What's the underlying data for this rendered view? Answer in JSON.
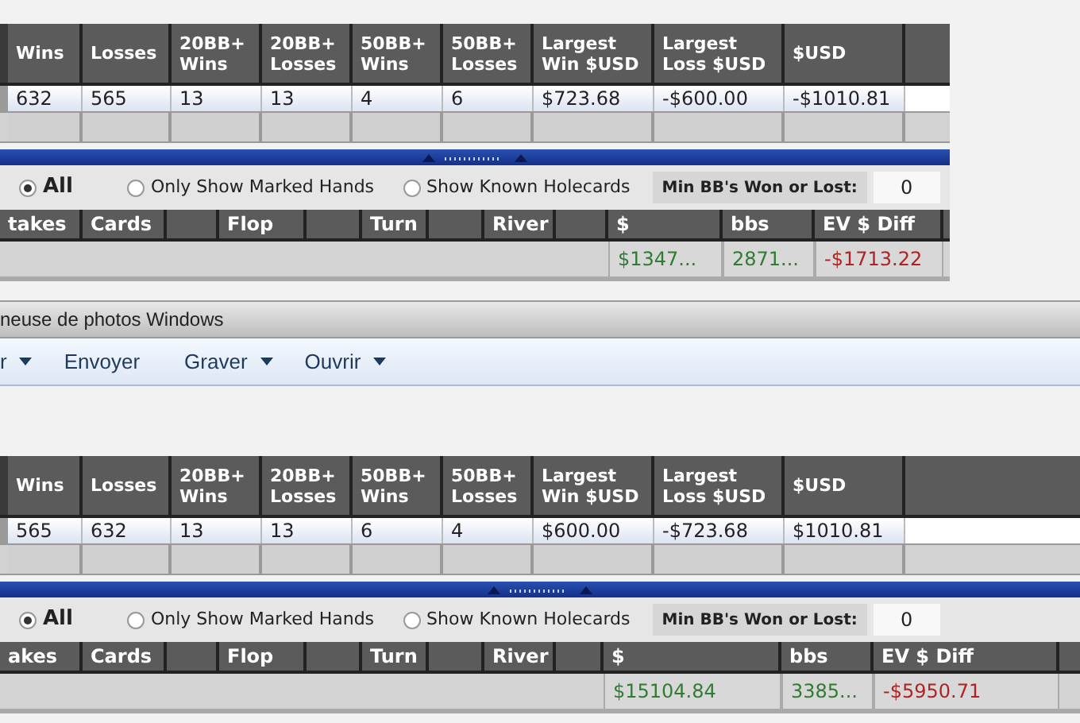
{
  "top_capture": {
    "stats_table": {
      "columns": [
        "Wins",
        "Losses",
        "20BB+ Wins",
        "20BB+ Losses",
        "50BB+ Wins",
        "50BB+ Losses",
        "Largest Win $USD",
        "Largest Loss $USD",
        "$USD"
      ],
      "row": [
        "632",
        "565",
        "13",
        "13",
        "4",
        "6",
        "$723.68",
        "-$600.00",
        "-$1010.81"
      ]
    },
    "filters": {
      "options": [
        {
          "label": "All",
          "selected": true
        },
        {
          "label": "Only Show Marked Hands",
          "selected": false
        },
        {
          "label": "Show Known Holecards",
          "selected": false
        }
      ],
      "min_label": "Min BB's Won or Lost:",
      "min_value": "0"
    },
    "hands_table": {
      "columns": [
        {
          "kind": "label",
          "label": "takes"
        },
        {
          "kind": "label",
          "label": "Cards"
        },
        {
          "kind": "blank"
        },
        {
          "kind": "label",
          "label": "Flop"
        },
        {
          "kind": "blank"
        },
        {
          "kind": "label",
          "label": "Turn"
        },
        {
          "kind": "blank"
        },
        {
          "kind": "label",
          "label": "River"
        },
        {
          "kind": "blank"
        },
        {
          "kind": "label",
          "label": "$",
          "total": "$1347...",
          "color": "#2e7d32"
        },
        {
          "kind": "label",
          "label": "bbs",
          "total": "2871...",
          "color": "#2e7d32"
        },
        {
          "kind": "label",
          "label": "EV $ Diff",
          "total": "-$1713.22",
          "color": "#b22222"
        }
      ]
    }
  },
  "photo_viewer": {
    "title": "neuse de photos Windows",
    "toolbar": [
      {
        "label": "r",
        "dropdown": true
      },
      {
        "label": "Envoyer",
        "dropdown": false
      },
      {
        "label": "Graver",
        "dropdown": true
      },
      {
        "label": "Ouvrir",
        "dropdown": true
      }
    ]
  },
  "bottom_capture": {
    "stats_table": {
      "columns": [
        "Wins",
        "Losses",
        "20BB+ Wins",
        "20BB+ Losses",
        "50BB+ Wins",
        "50BB+ Losses",
        "Largest Win $USD",
        "Largest Loss $USD",
        "$USD"
      ],
      "row": [
        "565",
        "632",
        "13",
        "13",
        "6",
        "4",
        "$600.00",
        "-$723.68",
        "$1010.81"
      ]
    },
    "filters": {
      "options": [
        {
          "label": "All",
          "selected": true
        },
        {
          "label": "Only Show Marked Hands",
          "selected": false
        },
        {
          "label": "Show Known Holecards",
          "selected": false
        }
      ],
      "min_label": "Min BB's Won or Lost:",
      "min_value": "0"
    },
    "hands_table": {
      "columns": [
        {
          "kind": "label",
          "label": "akes"
        },
        {
          "kind": "label",
          "label": "Cards"
        },
        {
          "kind": "blank"
        },
        {
          "kind": "label",
          "label": "Flop"
        },
        {
          "kind": "blank"
        },
        {
          "kind": "label",
          "label": "Turn"
        },
        {
          "kind": "blank"
        },
        {
          "kind": "label",
          "label": "River"
        },
        {
          "kind": "blank"
        },
        {
          "kind": "label",
          "label": "$",
          "total": "$15104.84",
          "color": "#2e7d32"
        },
        {
          "kind": "label",
          "label": "bbs",
          "total": "3385...",
          "color": "#2e7d32"
        },
        {
          "kind": "label",
          "label": "EV $ Diff",
          "total": "-$5950.71",
          "color": "#b22222"
        }
      ]
    }
  }
}
